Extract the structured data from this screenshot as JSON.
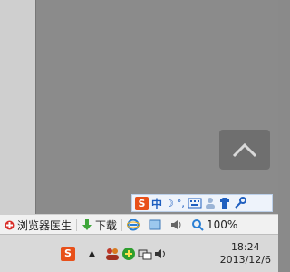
{
  "scroll_top": {
    "icon": "chevron-up-icon"
  },
  "ime": {
    "logo": "S",
    "mode": "中",
    "moon": "☽",
    "comma": "°,"
  },
  "statusbar": {
    "doctor_label": "浏览器医生",
    "download_label": "下载",
    "zoom": "100%"
  },
  "taskbar": {
    "logo": "S",
    "up_arrow": "▲",
    "time": "18:24",
    "date": "2013/12/6"
  }
}
